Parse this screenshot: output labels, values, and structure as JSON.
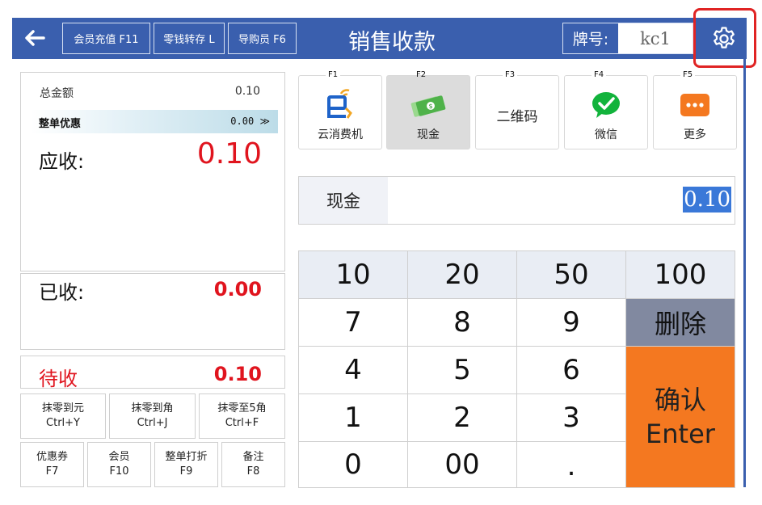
{
  "header": {
    "title": "销售收款",
    "buttons": {
      "recharge": "会员充值 F11",
      "change_deposit": "零钱转存 L",
      "guide": "导购员 F6"
    },
    "plate_label": "牌号:",
    "plate_value": "kc1"
  },
  "summary": {
    "total_label": "总金额",
    "total_value": "0.10",
    "discount_label": "整单优惠",
    "discount_value": "0.00",
    "receivable_label": "应收:",
    "receivable_value": "0.10",
    "received_label": "已收:",
    "received_value": "0.00",
    "due_label": "待收",
    "due_value": "0.10"
  },
  "functions": [
    {
      "label": "抹零到元",
      "key": "Ctrl+Y"
    },
    {
      "label": "抹零到角",
      "key": "Ctrl+J"
    },
    {
      "label": "抹零至5角",
      "key": "Ctrl+F"
    },
    {
      "label": "优惠券",
      "key": "F7"
    },
    {
      "label": "会员",
      "key": "F10"
    },
    {
      "label": "整单打折",
      "key": "F9"
    },
    {
      "label": "备注",
      "key": "F8"
    }
  ],
  "payment_methods": [
    {
      "key": "F1",
      "label": "云消费机",
      "icon": "cloud-pay-icon"
    },
    {
      "key": "F2",
      "label": "现金",
      "icon": "cash-icon",
      "selected": true
    },
    {
      "key": "F3",
      "label": "二维码",
      "icon": ""
    },
    {
      "key": "F4",
      "label": "微信",
      "icon": "wechat-icon"
    },
    {
      "key": "F5",
      "label": "更多",
      "icon": "more-icon"
    }
  ],
  "cash": {
    "label": "现金",
    "value": "0.10"
  },
  "keypad": {
    "quick": [
      "10",
      "20",
      "50",
      "100"
    ],
    "digits": [
      "7",
      "8",
      "9",
      "4",
      "5",
      "6",
      "1",
      "2",
      "3",
      "0",
      "00",
      "."
    ],
    "delete": "删除",
    "confirm_line1": "确认",
    "confirm_line2": "Enter"
  },
  "colors": {
    "header": "#3a5fae",
    "amount_red": "#e0141e",
    "confirm_orange": "#f47820",
    "delete_gray": "#8189a0",
    "highlight": "#e02424"
  }
}
